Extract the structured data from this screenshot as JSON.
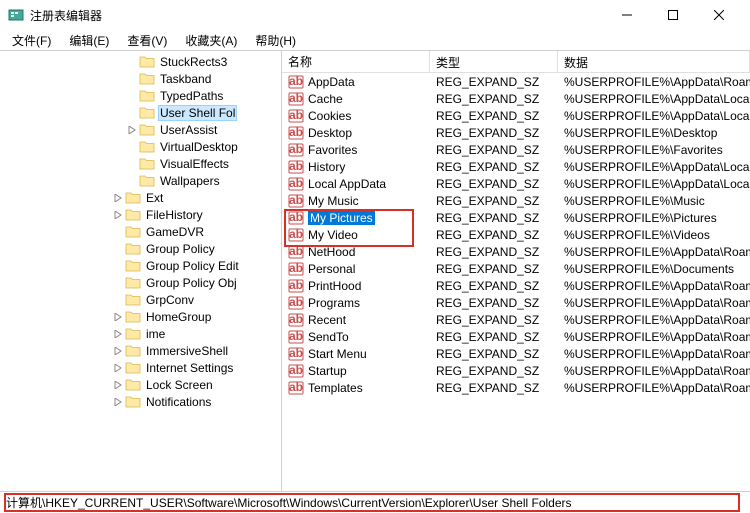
{
  "window": {
    "title": "注册表编辑器"
  },
  "menu": {
    "file": "文件(F)",
    "edit": "编辑(E)",
    "view": "查看(V)",
    "favorites": "收藏夹(A)",
    "help": "帮助(H)"
  },
  "tree": {
    "items": [
      {
        "indent": 9,
        "expander": "",
        "label": "StuckRects3"
      },
      {
        "indent": 9,
        "expander": "",
        "label": "Taskband"
      },
      {
        "indent": 9,
        "expander": "",
        "label": "TypedPaths"
      },
      {
        "indent": 9,
        "expander": "",
        "label": "User Shell Fol",
        "selected": true
      },
      {
        "indent": 9,
        "expander": ">",
        "label": "UserAssist"
      },
      {
        "indent": 9,
        "expander": "",
        "label": "VirtualDesktop"
      },
      {
        "indent": 9,
        "expander": "",
        "label": "VisualEffects"
      },
      {
        "indent": 9,
        "expander": "",
        "label": "Wallpapers"
      },
      {
        "indent": 8,
        "expander": ">",
        "label": "Ext"
      },
      {
        "indent": 8,
        "expander": ">",
        "label": "FileHistory"
      },
      {
        "indent": 8,
        "expander": "",
        "label": "GameDVR"
      },
      {
        "indent": 8,
        "expander": "",
        "label": "Group Policy"
      },
      {
        "indent": 8,
        "expander": "",
        "label": "Group Policy Edit"
      },
      {
        "indent": 8,
        "expander": "",
        "label": "Group Policy Obj"
      },
      {
        "indent": 8,
        "expander": "",
        "label": "GrpConv"
      },
      {
        "indent": 8,
        "expander": ">",
        "label": "HomeGroup"
      },
      {
        "indent": 8,
        "expander": ">",
        "label": "ime"
      },
      {
        "indent": 8,
        "expander": ">",
        "label": "ImmersiveShell"
      },
      {
        "indent": 8,
        "expander": ">",
        "label": "Internet Settings"
      },
      {
        "indent": 8,
        "expander": ">",
        "label": "Lock Screen"
      },
      {
        "indent": 8,
        "expander": ">",
        "label": "Notifications"
      }
    ]
  },
  "list": {
    "headers": {
      "name": "名称",
      "type": "类型",
      "data": "数据"
    },
    "rows": [
      {
        "name": "AppData",
        "type": "REG_EXPAND_SZ",
        "data": "%USERPROFILE%\\AppData\\Roamin"
      },
      {
        "name": "Cache",
        "type": "REG_EXPAND_SZ",
        "data": "%USERPROFILE%\\AppData\\Local\\N"
      },
      {
        "name": "Cookies",
        "type": "REG_EXPAND_SZ",
        "data": "%USERPROFILE%\\AppData\\Local\\N"
      },
      {
        "name": "Desktop",
        "type": "REG_EXPAND_SZ",
        "data": "%USERPROFILE%\\Desktop"
      },
      {
        "name": "Favorites",
        "type": "REG_EXPAND_SZ",
        "data": "%USERPROFILE%\\Favorites"
      },
      {
        "name": "History",
        "type": "REG_EXPAND_SZ",
        "data": "%USERPROFILE%\\AppData\\Local\\N"
      },
      {
        "name": "Local AppData",
        "type": "REG_EXPAND_SZ",
        "data": "%USERPROFILE%\\AppData\\Local"
      },
      {
        "name": "My Music",
        "type": "REG_EXPAND_SZ",
        "data": "%USERPROFILE%\\Music"
      },
      {
        "name": "My Pictures",
        "type": "REG_EXPAND_SZ",
        "data": "%USERPROFILE%\\Pictures",
        "selected": true
      },
      {
        "name": "My Video",
        "type": "REG_EXPAND_SZ",
        "data": "%USERPROFILE%\\Videos"
      },
      {
        "name": "NetHood",
        "type": "REG_EXPAND_SZ",
        "data": "%USERPROFILE%\\AppData\\Roamin"
      },
      {
        "name": "Personal",
        "type": "REG_EXPAND_SZ",
        "data": "%USERPROFILE%\\Documents"
      },
      {
        "name": "PrintHood",
        "type": "REG_EXPAND_SZ",
        "data": "%USERPROFILE%\\AppData\\Roamin"
      },
      {
        "name": "Programs",
        "type": "REG_EXPAND_SZ",
        "data": "%USERPROFILE%\\AppData\\Roamin"
      },
      {
        "name": "Recent",
        "type": "REG_EXPAND_SZ",
        "data": "%USERPROFILE%\\AppData\\Roamin"
      },
      {
        "name": "SendTo",
        "type": "REG_EXPAND_SZ",
        "data": "%USERPROFILE%\\AppData\\Roamin"
      },
      {
        "name": "Start Menu",
        "type": "REG_EXPAND_SZ",
        "data": "%USERPROFILE%\\AppData\\Roamin"
      },
      {
        "name": "Startup",
        "type": "REG_EXPAND_SZ",
        "data": "%USERPROFILE%\\AppData\\Roamin"
      },
      {
        "name": "Templates",
        "type": "REG_EXPAND_SZ",
        "data": "%USERPROFILE%\\AppData\\Roamin"
      }
    ]
  },
  "status": {
    "path": "计算机\\HKEY_CURRENT_USER\\Software\\Microsoft\\Windows\\CurrentVersion\\Explorer\\User Shell Folders"
  }
}
